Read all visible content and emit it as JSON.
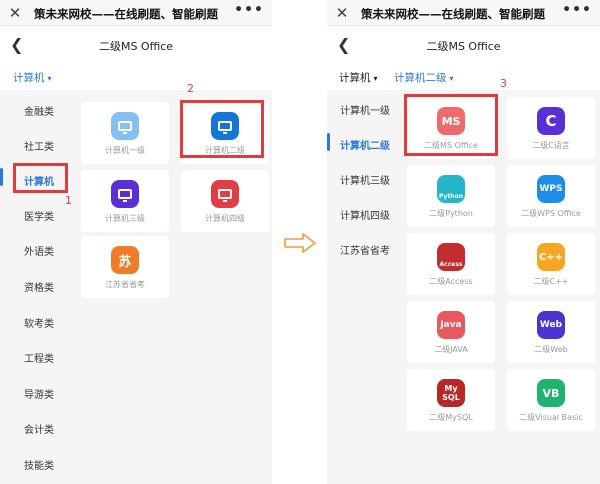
{
  "colors": {
    "accent": "#2d79d6",
    "highlight": "#e23b3b",
    "arrow": "#f29b3a"
  },
  "window": {
    "title": "策未来网校——在线刷题、智能刷题",
    "close_icon": "close-icon",
    "more_icon": "more-icon"
  },
  "left": {
    "page_title": "二级MS Office",
    "crumbs": [
      "计算机"
    ],
    "sidebar": [
      "金融类",
      "社工类",
      "计算机",
      "医学类",
      "外语类",
      "资格类",
      "软考类",
      "工程类",
      "导游类",
      "会计类",
      "技能类"
    ],
    "sidebar_active": "计算机",
    "cards": [
      {
        "label": "计算机一级",
        "icon": "monitor-icon",
        "color": "#86c0f2"
      },
      {
        "label": "计算机二级",
        "icon": "monitor-icon",
        "color": "#1576d8"
      },
      {
        "label": "计算机三级",
        "icon": "monitor-icon",
        "color": "#5a2fd6"
      },
      {
        "label": "计算机四级",
        "icon": "monitor-icon",
        "color": "#e23d47"
      },
      {
        "label": "江苏省省考",
        "icon": "su-icon",
        "glyph": "苏",
        "color": "#f07c2a"
      }
    ],
    "annotations": [
      "1",
      "2"
    ]
  },
  "right": {
    "page_title": "二级MS Office",
    "crumbs": [
      "计算机",
      "计算机二级"
    ],
    "sidebar": [
      "计算机一级",
      "计算机二级",
      "计算机三级",
      "计算机四级",
      "江苏省省考"
    ],
    "sidebar_active": "计算机二级",
    "cards": [
      {
        "label": "二级MS Office",
        "glyph": "MS",
        "color": "#ee6b6b"
      },
      {
        "label": "二级C语言",
        "glyph": "C",
        "color": "#5a2fd6"
      },
      {
        "label": "二级Python",
        "glyph": "Python",
        "color": "#25b7c9"
      },
      {
        "label": "二级WPS Office",
        "glyph": "WPS",
        "color": "#1e8de6"
      },
      {
        "label": "二级Access",
        "glyph": "Access",
        "color": "#c32d2d"
      },
      {
        "label": "二级C++",
        "glyph": "C++",
        "color": "#f6a623"
      },
      {
        "label": "二级JAVA",
        "glyph": "Java",
        "color": "#e8585e"
      },
      {
        "label": "二级Web",
        "glyph": "Web",
        "color": "#4a35d0"
      },
      {
        "label": "二级MySQL",
        "glyph": "My SQL",
        "color": "#b72828"
      },
      {
        "label": "二级Visual Basic",
        "glyph": "VB",
        "color": "#1fb36f"
      }
    ],
    "annotations": [
      "3"
    ]
  }
}
